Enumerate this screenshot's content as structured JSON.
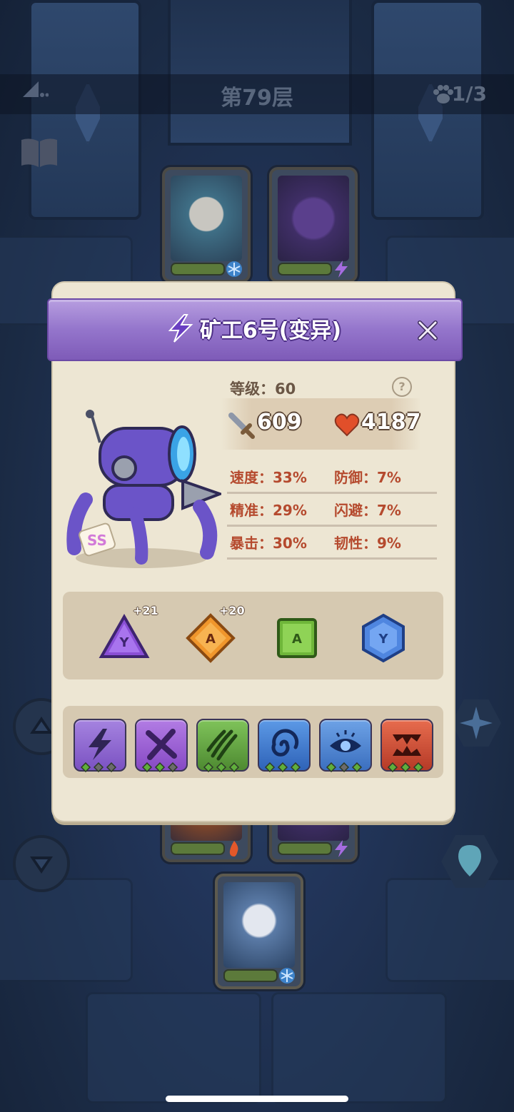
{
  "header": {
    "floor_title": "第79层",
    "team_count": "1/3"
  },
  "dialog": {
    "title": "矿工6号(变异)",
    "level": "等级：60",
    "attack": "609",
    "hp": "4187",
    "stats": [
      {
        "left": "速度：33%",
        "right": "防御：7%"
      },
      {
        "left": "精准：29%",
        "right": "闪避：7%"
      },
      {
        "left": "暴击：30%",
        "right": "韧性：9%"
      }
    ],
    "grade_badge": "SS",
    "runes": [
      {
        "letter": "Y",
        "shape": "triangle",
        "color": "#8a4fd6",
        "bonus": "+21"
      },
      {
        "letter": "A",
        "shape": "diamond",
        "color": "#f0962c",
        "bonus": "+20"
      },
      {
        "letter": "A",
        "shape": "square",
        "color": "#6fb73a",
        "bonus": ""
      },
      {
        "letter": "Y",
        "shape": "hexagon",
        "color": "#4f86e0",
        "bonus": ""
      }
    ],
    "skills": [
      {
        "icon": "lightning-icon",
        "color": "#8e63cf"
      },
      {
        "icon": "x-slash-icon",
        "color": "#9a5cd0"
      },
      {
        "icon": "claw-icon",
        "color": "#5a9d3d"
      },
      {
        "icon": "swirl-icon",
        "color": "#3e78cc"
      },
      {
        "icon": "eye-icon",
        "color": "#4c86d1"
      },
      {
        "icon": "fang-icon",
        "color": "#d1503a"
      }
    ]
  },
  "colors": {
    "dialog_bg": "#ede6d3",
    "header_purple": "#9576cc",
    "stat_text": "#b54a2e"
  }
}
